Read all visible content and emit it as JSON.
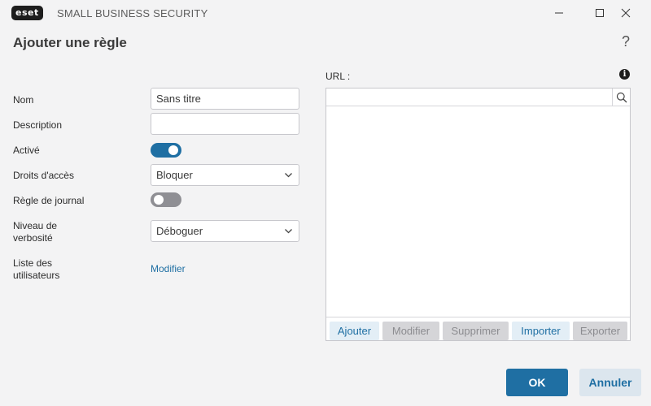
{
  "titlebar": {
    "logo_text": "eset",
    "app_title": "SMALL BUSINESS SECURITY"
  },
  "page": {
    "title": "Ajouter une règle",
    "help_glyph": "?"
  },
  "form": {
    "name_label": "Nom",
    "name_value": "Sans titre",
    "description_label": "Description",
    "description_value": "",
    "active_label": "Activé",
    "active_on": true,
    "access_label": "Droits d'accès",
    "access_value": "Bloquer",
    "log_label": "Règle de journal",
    "log_on": false,
    "verbosity_label_1": "Niveau de",
    "verbosity_label_2": "verbosité",
    "verbosity_value": "Déboguer",
    "users_label_1": "Liste des",
    "users_label_2": "utilisateurs",
    "users_link": "Modifier"
  },
  "url_panel": {
    "label": "URL :",
    "search_value": "",
    "items": [],
    "actions": {
      "add": "Ajouter",
      "edit": "Modifier",
      "delete": "Supprimer",
      "import": "Importer",
      "export": "Exporter"
    }
  },
  "footer": {
    "ok": "OK",
    "cancel": "Annuler"
  },
  "colors": {
    "accent": "#1f6fa3",
    "background": "#f3f3f4",
    "toggle_off": "#8f8f94"
  },
  "icons": {
    "minimize": "minimize-icon",
    "maximize": "maximize-icon",
    "close": "close-icon",
    "help": "question-mark-icon",
    "info": "info-icon",
    "search": "search-icon",
    "dropdown": "chevron-down-icon"
  }
}
